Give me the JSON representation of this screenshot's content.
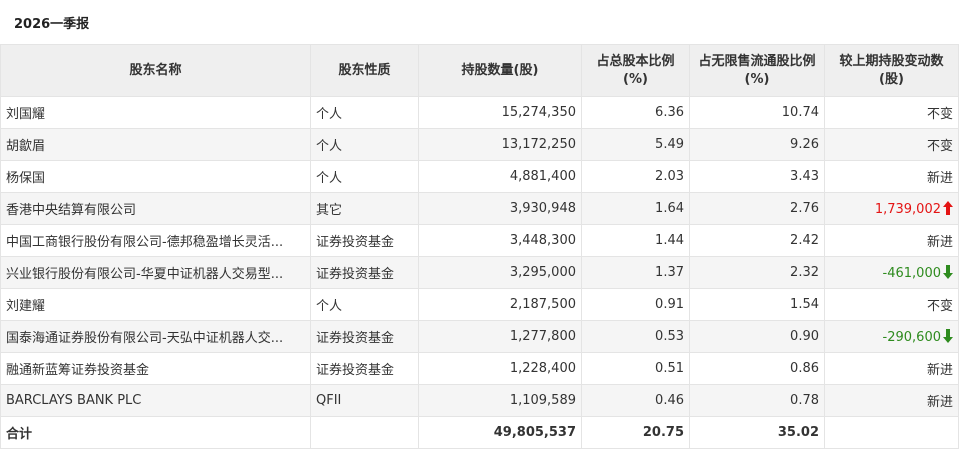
{
  "report": {
    "title": "2026一季报"
  },
  "table": {
    "headers": {
      "name": "股东名称",
      "type": "股东性质",
      "shares": "持股数量(股)",
      "total_pct": "占总股本比例(%)",
      "float_pct": "占无限售流通股比例(%)",
      "change": "较上期持股变动数(股)"
    },
    "rows": [
      {
        "name": "刘国耀",
        "type": "个人",
        "shares": "15,274,350",
        "total_pct": "6.36",
        "float_pct": "10.74",
        "change": "不变",
        "direction": "none"
      },
      {
        "name": "胡歙眉",
        "type": "个人",
        "shares": "13,172,250",
        "total_pct": "5.49",
        "float_pct": "9.26",
        "change": "不变",
        "direction": "none"
      },
      {
        "name": "杨保国",
        "type": "个人",
        "shares": "4,881,400",
        "total_pct": "2.03",
        "float_pct": "3.43",
        "change": "新进",
        "direction": "none"
      },
      {
        "name": "香港中央结算有限公司",
        "type": "其它",
        "shares": "3,930,948",
        "total_pct": "1.64",
        "float_pct": "2.76",
        "change": "1,739,002",
        "direction": "up"
      },
      {
        "name": "中国工商银行股份有限公司-德邦稳盈增长灵活...",
        "type": "证券投资基金",
        "shares": "3,448,300",
        "total_pct": "1.44",
        "float_pct": "2.42",
        "change": "新进",
        "direction": "none"
      },
      {
        "name": "兴业银行股份有限公司-华夏中证机器人交易型...",
        "type": "证券投资基金",
        "shares": "3,295,000",
        "total_pct": "1.37",
        "float_pct": "2.32",
        "change": "-461,000",
        "direction": "down"
      },
      {
        "name": "刘建耀",
        "type": "个人",
        "shares": "2,187,500",
        "total_pct": "0.91",
        "float_pct": "1.54",
        "change": "不变",
        "direction": "none"
      },
      {
        "name": "国泰海通证券股份有限公司-天弘中证机器人交...",
        "type": "证券投资基金",
        "shares": "1,277,800",
        "total_pct": "0.53",
        "float_pct": "0.90",
        "change": "-290,600",
        "direction": "down"
      },
      {
        "name": "融通新蓝筹证券投资基金",
        "type": "证券投资基金",
        "shares": "1,228,400",
        "total_pct": "0.51",
        "float_pct": "0.86",
        "change": "新进",
        "direction": "none"
      },
      {
        "name": "BARCLAYS BANK PLC",
        "type": "QFII",
        "shares": "1,109,589",
        "total_pct": "0.46",
        "float_pct": "0.78",
        "change": "新进",
        "direction": "none"
      }
    ],
    "total": {
      "label": "合计",
      "shares": "49,805,537",
      "total_pct": "20.75",
      "float_pct": "35.02"
    }
  },
  "colors": {
    "up": "#e41414",
    "down": "#2e8b1e",
    "header_bg": "#efefef",
    "stripe_bg": "#f5f5f5",
    "corner_flag": "#ff6a00"
  }
}
